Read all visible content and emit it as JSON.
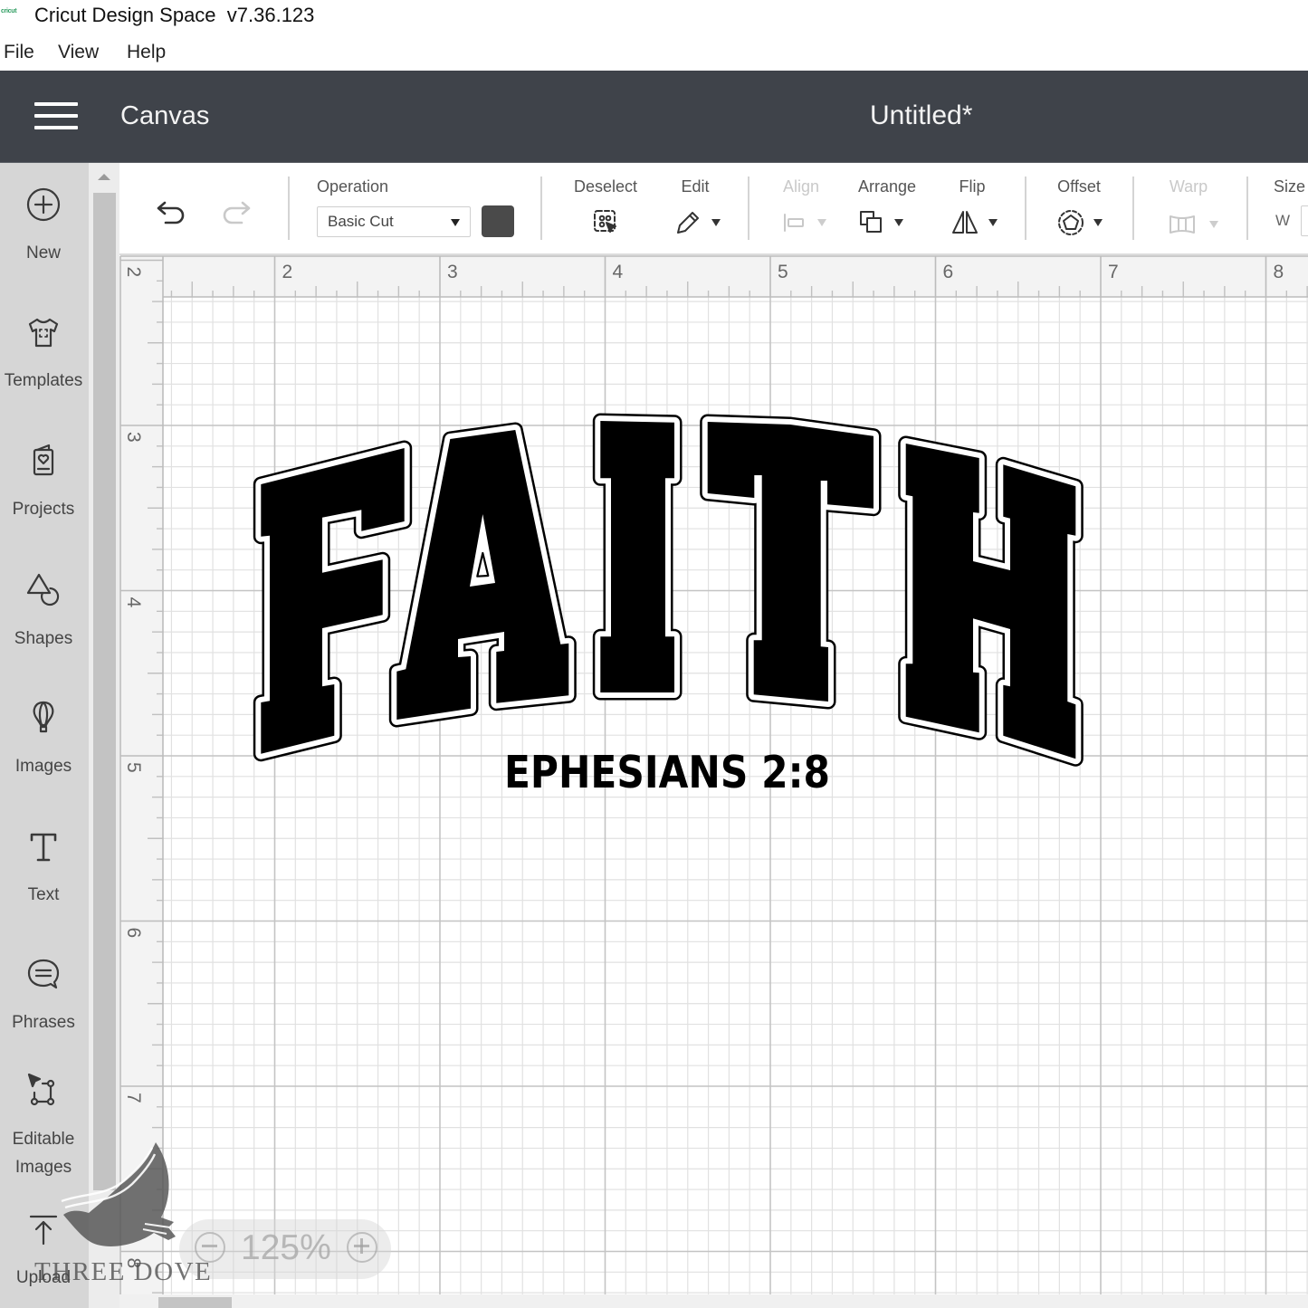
{
  "app": {
    "logo_text": "cricut",
    "title": "Cricut Design Space  v7.36.123"
  },
  "menu": {
    "items": [
      {
        "label": "File"
      },
      {
        "label": "View"
      },
      {
        "label": "Help"
      }
    ]
  },
  "header": {
    "menu_icon": "hamburger-icon",
    "section": "Canvas",
    "document_title": "Untitled*",
    "background": "#3f434a"
  },
  "sidebar": {
    "items": [
      {
        "label": "New",
        "icon": "plus-circle-icon"
      },
      {
        "label": "Templates",
        "icon": "tshirt-icon"
      },
      {
        "label": "Projects",
        "icon": "project-card-icon"
      },
      {
        "label": "Shapes",
        "icon": "shapes-icon"
      },
      {
        "label": "Images",
        "icon": "balloon-icon"
      },
      {
        "label": "Text",
        "icon": "text-t-icon"
      },
      {
        "label": "Phrases",
        "icon": "speech-bubble-icon"
      },
      {
        "label": "Editable Images",
        "icon": "editable-image-icon"
      },
      {
        "label": "Upload",
        "icon": "upload-icon"
      }
    ]
  },
  "toolbar": {
    "undo": {
      "icon": "undo-icon",
      "enabled": true
    },
    "redo": {
      "icon": "redo-icon",
      "enabled": false
    },
    "operation": {
      "label": "Operation",
      "value": "Basic Cut",
      "color": "#4a4a4a"
    },
    "deselect": {
      "label": "Deselect",
      "icon": "deselect-icon"
    },
    "edit": {
      "label": "Edit",
      "icon": "pencil-icon"
    },
    "align": {
      "label": "Align",
      "icon": "align-icon",
      "enabled": false
    },
    "arrange": {
      "label": "Arrange",
      "icon": "arrange-icon"
    },
    "flip": {
      "label": "Flip",
      "icon": "flip-icon"
    },
    "offset": {
      "label": "Offset",
      "icon": "offset-icon"
    },
    "warp": {
      "label": "Warp",
      "icon": "warp-icon",
      "enabled": false
    },
    "size": {
      "label": "Size",
      "w_label": "W",
      "w_value": ""
    }
  },
  "rulers": {
    "unit": "in",
    "top_labels": [
      "2",
      "3",
      "4",
      "5",
      "6",
      "7",
      "8"
    ],
    "left_labels": [
      "2",
      "3",
      "4",
      "5",
      "6",
      "7",
      "8"
    ]
  },
  "canvas": {
    "design": {
      "headline": "FAITH",
      "letters": [
        "F",
        "A",
        "I",
        "T",
        "H"
      ],
      "subtitle": "EPHESIANS 2:8",
      "fill_color": "#000000",
      "offset_outline_color": "#000000"
    }
  },
  "zoom": {
    "level": "125%",
    "minus_icon": "zoom-out-icon",
    "plus_icon": "zoom-in-icon"
  },
  "watermark": {
    "text": "THREE DOVE",
    "icon": "dove-icon"
  }
}
